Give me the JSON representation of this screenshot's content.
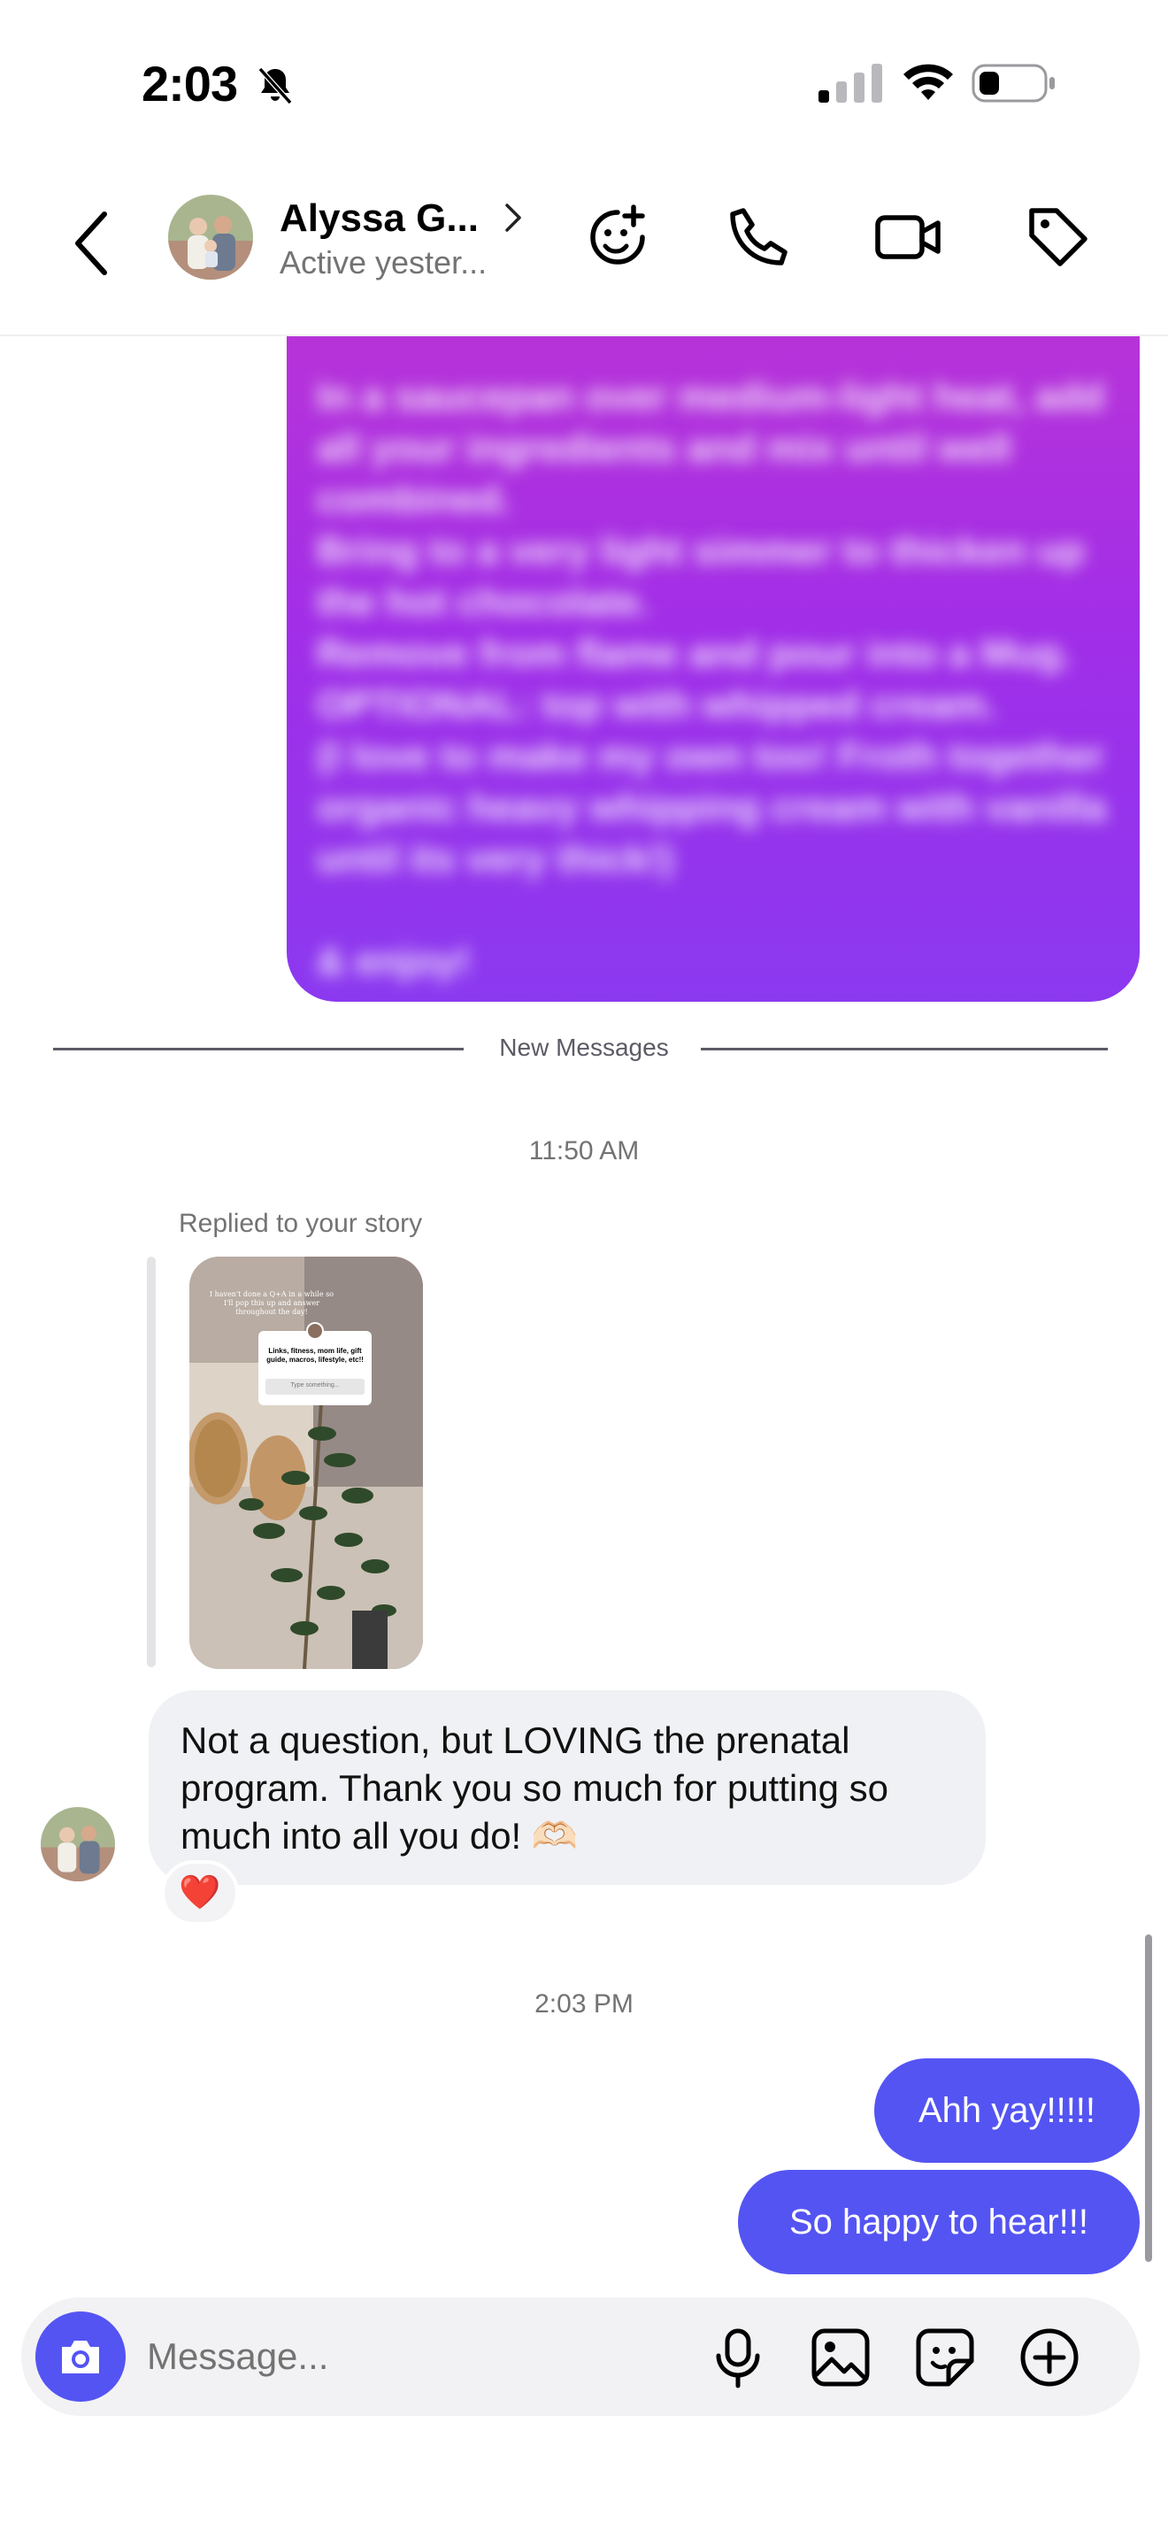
{
  "status_bar": {
    "time": "2:03",
    "bell": "bell-slash-icon",
    "signal": "cellular-signal-icon",
    "wifi": "wifi-icon",
    "battery": "battery-icon"
  },
  "header": {
    "back": "chevron-left-icon",
    "contact_name": "Alyssa G...",
    "contact_status": "Active yester...",
    "icons": [
      "sticker-add-icon",
      "phone-icon",
      "video-icon",
      "tag-icon"
    ]
  },
  "chat": {
    "blurred_message": "In a saucepan over medium-light heat, add all your ingredients and mix until well combined.\nBring to a very light simmer to thicken up the hot chocolate.\nRemove from flame and pour into a Mug.\nOPTIONAL: top with whipped cream.\n(I love to make my own too! Froth together organic heavy whipping cream with vanilla until its very thick!)\n\n& enjoy!",
    "new_messages_label": "New Messages",
    "timestamp_1": "11:50 AM",
    "reply_label": "Replied to your story",
    "story_card": {
      "overlay_text": "I haven't done a Q+A in a while so I'll pop this up and answer throughout the day!",
      "card_text": "Links, fitness, mom life, gift guide, macros, lifestyle, etc!!",
      "card_input": "Type something..."
    },
    "incoming_message": "Not a question, but LOVING the prenatal program. Thank you so much for putting so much into all you do! 🫶🏻",
    "reaction": "❤️",
    "timestamp_2": "2:03 PM",
    "outgoing": [
      "Ahh yay!!!!!",
      "So happy to hear!!!"
    ]
  },
  "composer": {
    "placeholder": "Message...",
    "icons": [
      "camera-icon",
      "microphone-icon",
      "image-icon",
      "sticker-icon",
      "plus-circle-icon"
    ]
  },
  "colors": {
    "accent": "#5454F3",
    "bubble_gradient_top": "#B733D9",
    "bubble_gradient_bottom": "#8B39F0",
    "incoming_bubble": "#F0F1F4"
  }
}
